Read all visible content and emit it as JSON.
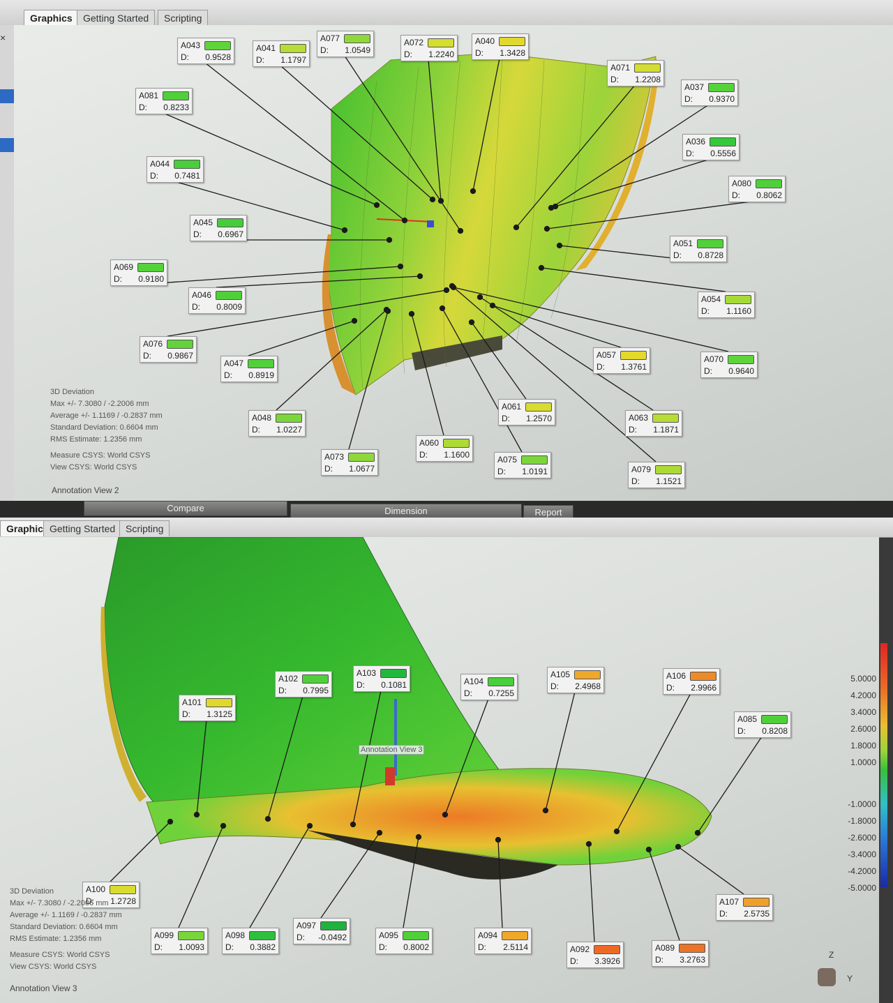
{
  "top": {
    "tabs": [
      {
        "label": "Graphics",
        "active": true
      },
      {
        "label": "Getting Started",
        "active": false
      },
      {
        "label": "Scripting",
        "active": false
      }
    ],
    "stats": {
      "title": "3D Deviation",
      "max": "Max +/- 7.3080 / -2.2006 mm",
      "avg": "Average +/- 1.1169 / -0.2837 mm",
      "std": "Standard Deviation: 0.6604 mm",
      "rms": "RMS Estimate: 1.2356 mm",
      "measure": "Measure CSYS: World CSYS",
      "view": "View CSYS: World CSYS"
    },
    "status": "Annotation View 2",
    "annotations": [
      {
        "id": "A043",
        "d_label": "D:",
        "value": "0.9528",
        "color": "#5fd43a"
      },
      {
        "id": "A041",
        "d_label": "D:",
        "value": "1.1797",
        "color": "#b6dc35"
      },
      {
        "id": "A077",
        "d_label": "D:",
        "value": "1.0549",
        "color": "#8ed83a"
      },
      {
        "id": "A072",
        "d_label": "D:",
        "value": "1.2240",
        "color": "#d4de30"
      },
      {
        "id": "A040",
        "d_label": "D:",
        "value": "1.3428",
        "color": "#e0d82c"
      },
      {
        "id": "A071",
        "d_label": "D:",
        "value": "1.2208",
        "color": "#d4de30"
      },
      {
        "id": "A081",
        "d_label": "D:",
        "value": "0.8233",
        "color": "#4fd03a"
      },
      {
        "id": "A037",
        "d_label": "D:",
        "value": "0.9370",
        "color": "#55d23a"
      },
      {
        "id": "A044",
        "d_label": "D:",
        "value": "0.7481",
        "color": "#49ce3c"
      },
      {
        "id": "A036",
        "d_label": "D:",
        "value": "0.5556",
        "color": "#35c83a"
      },
      {
        "id": "A080",
        "d_label": "D:",
        "value": "0.8062",
        "color": "#4fd03a"
      },
      {
        "id": "A045",
        "d_label": "D:",
        "value": "0.6967",
        "color": "#45cc3c"
      },
      {
        "id": "A051",
        "d_label": "D:",
        "value": "0.8728",
        "color": "#52d03a"
      },
      {
        "id": "A069",
        "d_label": "D:",
        "value": "0.9180",
        "color": "#55d23a"
      },
      {
        "id": "A046",
        "d_label": "D:",
        "value": "0.8009",
        "color": "#4fd03a"
      },
      {
        "id": "A054",
        "d_label": "D:",
        "value": "1.1160",
        "color": "#a6da38"
      },
      {
        "id": "A076",
        "d_label": "D:",
        "value": "0.9867",
        "color": "#62d43a"
      },
      {
        "id": "A047",
        "d_label": "D:",
        "value": "0.8919",
        "color": "#52d03a"
      },
      {
        "id": "A057",
        "d_label": "D:",
        "value": "1.3761",
        "color": "#e4d82c"
      },
      {
        "id": "A070",
        "d_label": "D:",
        "value": "0.9640",
        "color": "#5fd43a"
      },
      {
        "id": "A061",
        "d_label": "D:",
        "value": "1.2570",
        "color": "#d8dc2e"
      },
      {
        "id": "A063",
        "d_label": "D:",
        "value": "1.1871",
        "color": "#b6dc35"
      },
      {
        "id": "A048",
        "d_label": "D:",
        "value": "1.0227",
        "color": "#7ad63a"
      },
      {
        "id": "A060",
        "d_label": "D:",
        "value": "1.1600",
        "color": "#aeda36"
      },
      {
        "id": "A073",
        "d_label": "D:",
        "value": "1.0677",
        "color": "#8ed83a"
      },
      {
        "id": "A075",
        "d_label": "D:",
        "value": "1.0191",
        "color": "#7ad63a"
      },
      {
        "id": "A079",
        "d_label": "D:",
        "value": "1.1521",
        "color": "#aeda36"
      }
    ]
  },
  "bottom": {
    "tabs": [
      {
        "label": "Graphics",
        "active": true
      },
      {
        "label": "Getting Started",
        "active": false
      },
      {
        "label": "Scripting",
        "active": false
      }
    ],
    "controls": [
      {
        "label": "Compare"
      },
      {
        "label": "Dimension"
      },
      {
        "label": "Report"
      }
    ],
    "viewport_tag": "Annotation View 3",
    "stats": {
      "title": "3D Deviation",
      "max": "Max +/- 7.3080 / -2.2006 mm",
      "avg": "Average +/- 1.1169 / -0.2837 mm",
      "std": "Standard Deviation: 0.6604 mm",
      "rms": "RMS Estimate: 1.2356 mm",
      "measure": "Measure CSYS: World CSYS",
      "view": "View CSYS: World CSYS"
    },
    "status": "Annotation View 3",
    "annotations": [
      {
        "id": "A101",
        "d_label": "D:",
        "value": "1.3125",
        "color": "#e0d82c"
      },
      {
        "id": "A102",
        "d_label": "D:",
        "value": "0.7995",
        "color": "#4fd03a"
      },
      {
        "id": "A103",
        "d_label": "D:",
        "value": "0.1081",
        "color": "#22b83c"
      },
      {
        "id": "A104",
        "d_label": "D:",
        "value": "0.7255",
        "color": "#49ce3c"
      },
      {
        "id": "A105",
        "d_label": "D:",
        "value": "2.4968",
        "color": "#f0a82a"
      },
      {
        "id": "A106",
        "d_label": "D:",
        "value": "2.9966",
        "color": "#ef8a28"
      },
      {
        "id": "A085",
        "d_label": "D:",
        "value": "0.8208",
        "color": "#4fd03a"
      },
      {
        "id": "A100",
        "d_label": "D:",
        "value": "1.2728",
        "color": "#d8dc2e"
      },
      {
        "id": "A107",
        "d_label": "D:",
        "value": "2.5735",
        "color": "#f0a02a"
      },
      {
        "id": "A099",
        "d_label": "D:",
        "value": "1.0093",
        "color": "#78d63a"
      },
      {
        "id": "A098",
        "d_label": "D:",
        "value": "0.3882",
        "color": "#2ec03c"
      },
      {
        "id": "A097",
        "d_label": "D:",
        "value": "-0.0492",
        "color": "#1fb23e"
      },
      {
        "id": "A095",
        "d_label": "D:",
        "value": "0.8002",
        "color": "#4fd03a"
      },
      {
        "id": "A094",
        "d_label": "D:",
        "value": "2.5114",
        "color": "#f0a82a"
      },
      {
        "id": "A092",
        "d_label": "D:",
        "value": "3.3926",
        "color": "#ec6a26"
      },
      {
        "id": "A089",
        "d_label": "D:",
        "value": "3.2763",
        "color": "#ec7426"
      }
    ],
    "legend": [
      "5.0000",
      "4.2000",
      "3.4000",
      "2.6000",
      "1.8000",
      "1.0000",
      "-1.0000",
      "-1.8000",
      "-2.6000",
      "-3.4000",
      "-4.2000",
      "-5.0000"
    ],
    "axes": {
      "z": "Z",
      "y": "Y"
    }
  }
}
